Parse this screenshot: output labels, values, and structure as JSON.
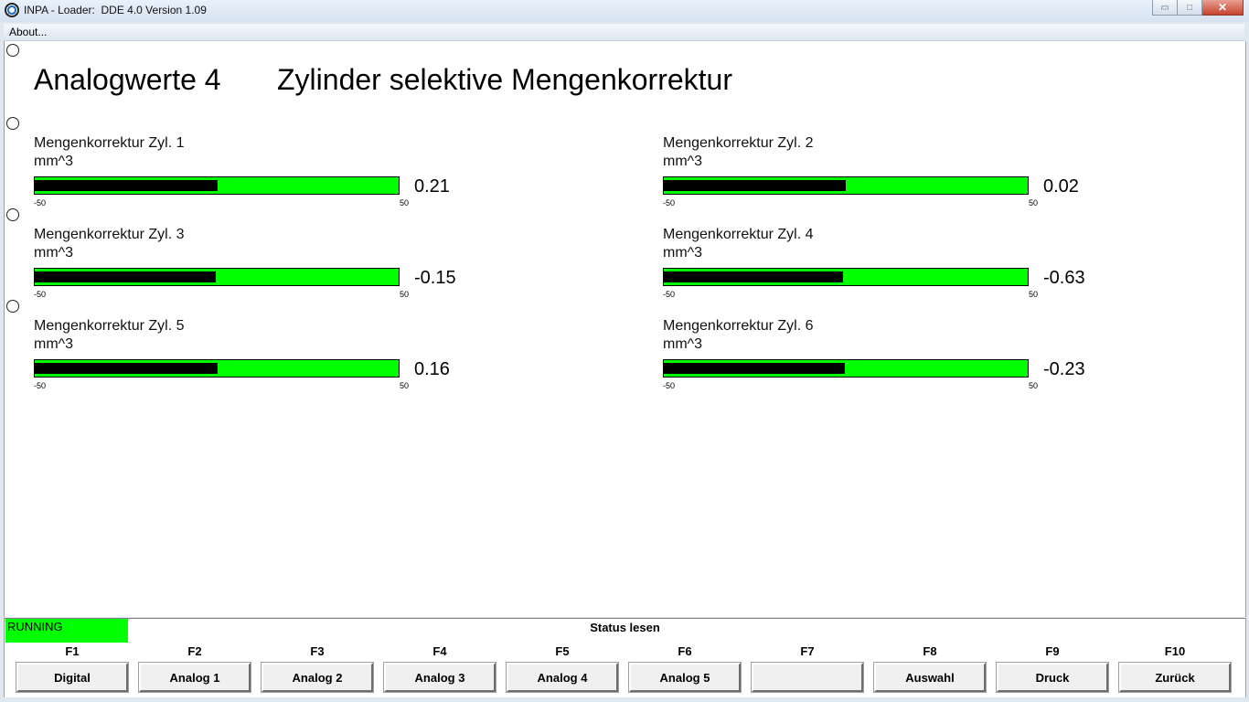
{
  "window": {
    "title": "INPA - Loader:  DDE 4.0 Version 1.09",
    "minimize_glyph": "▭",
    "maximize_glyph": "□",
    "close_glyph": "✕"
  },
  "menu": {
    "about_label": "About..."
  },
  "page": {
    "heading_left": "Analogwerte 4",
    "heading_right": "Zylinder selektive Mengenkorrektur"
  },
  "gauges": [
    {
      "label": "Mengenkorrektur Zyl. 1",
      "unit": "mm^3",
      "min": "-50",
      "max": "50",
      "value": "0.21",
      "level": 0.0021
    },
    {
      "label": "Mengenkorrektur Zyl. 2",
      "unit": "mm^3",
      "min": "-50",
      "max": "50",
      "value": "0.02",
      "level": 0.0002
    },
    {
      "label": "Mengenkorrektur Zyl. 3",
      "unit": "mm^3",
      "min": "-50",
      "max": "50",
      "value": "-0.15",
      "level": -0.0015
    },
    {
      "label": "Mengenkorrektur Zyl. 4",
      "unit": "mm^3",
      "min": "-50",
      "max": "50",
      "value": "-0.63",
      "level": -0.0063
    },
    {
      "label": "Mengenkorrektur Zyl. 5",
      "unit": "mm^3",
      "min": "-50",
      "max": "50",
      "value": "0.16",
      "level": 0.0016
    },
    {
      "label": "Mengenkorrektur Zyl. 6",
      "unit": "mm^3",
      "min": "-50",
      "max": "50",
      "value": "-0.23",
      "level": -0.0023
    }
  ],
  "status": {
    "running_label": "RUNNING",
    "running_color": "#00ff00",
    "title": "Status lesen"
  },
  "fkeys": [
    {
      "key": "F1",
      "label": "Digital"
    },
    {
      "key": "F2",
      "label": "Analog 1"
    },
    {
      "key": "F3",
      "label": "Analog 2"
    },
    {
      "key": "F4",
      "label": "Analog 3"
    },
    {
      "key": "F5",
      "label": "Analog 4"
    },
    {
      "key": "F6",
      "label": "Analog 5"
    },
    {
      "key": "F7",
      "label": ""
    },
    {
      "key": "F8",
      "label": "Auswahl"
    },
    {
      "key": "F9",
      "label": "Druck"
    },
    {
      "key": "F10",
      "label": "Zurück"
    }
  ],
  "colors": {
    "bar_background": "#00ff00",
    "bar_fill": "#000000"
  }
}
